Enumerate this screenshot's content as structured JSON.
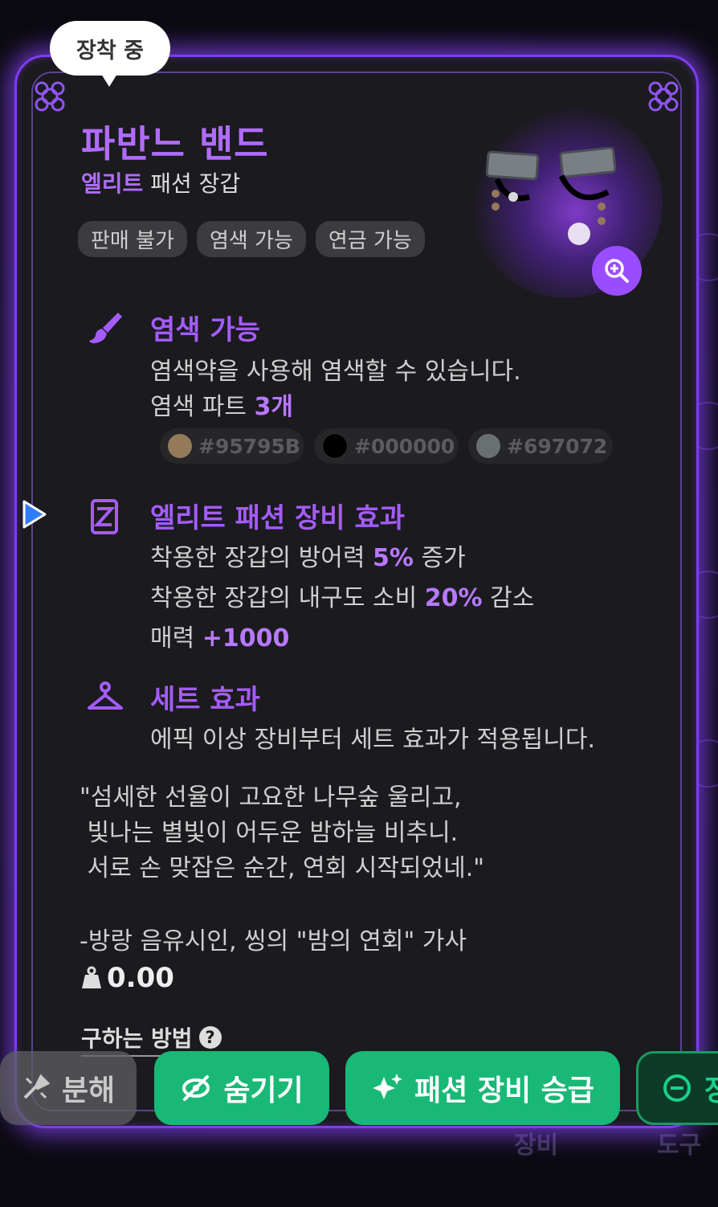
{
  "badge": {
    "equipped": "장착 중"
  },
  "item": {
    "name": "파반느 밴드",
    "grade": "엘리트",
    "type": "패션 장갑",
    "icon": "glove-bracelet-image"
  },
  "chips": [
    "판매 불가",
    "염색 가능",
    "연금 가능"
  ],
  "zoom_icon": "zoom-in-icon",
  "dye": {
    "icon": "brush-icon",
    "title": "염색 가능",
    "desc": "염색약을 사용해 염색할 수 있습니다.",
    "parts_label": "염색 파트",
    "parts_count": "3개",
    "colors": [
      {
        "code": "#95795B",
        "color": "#95795B"
      },
      {
        "code": "#000000",
        "color": "#000000"
      },
      {
        "code": "#697072",
        "color": "#697072"
      }
    ]
  },
  "elite_effect": {
    "icon": "fashion-card-icon",
    "title": "엘리트 패션 장비 효과",
    "line1_text": "착용한 장갑의 방어력",
    "line1_value": "5%",
    "line1_suffix": "증가",
    "line2_text": "착용한 장갑의 내구도 소비",
    "line2_value": "20%",
    "line2_suffix": "감소",
    "line3_text": "매력",
    "line3_value": "+1000"
  },
  "set_effect": {
    "icon": "hanger-icon",
    "title": "세트 효과",
    "desc": "에픽 이상 장비부터 세트 효과가 적용됩니다."
  },
  "flavor": {
    "quote": "\"섬세한 선율이 고요한 나무숲 울리고,\n 빛나는 별빛이 어두운 밤하늘 비추니.\n 서로 손 맞잡은 순간, 연회 시작되었네.\"",
    "author": "-방랑 음유시인, 씽의 \"밤의 연회\" 가사"
  },
  "weight": {
    "icon": "weight-icon",
    "value": "0.00"
  },
  "how_to": {
    "label": "구하는 방법",
    "icon": "help-icon"
  },
  "buttons": {
    "disassemble": "분해",
    "hide": "숨기기",
    "upgrade": "패션 장비 승급",
    "unequip": "장"
  },
  "bottom_nav": {
    "equipment": "장비",
    "tools": "도구"
  },
  "colors": {
    "accent": "#9a4dff",
    "title": "#b06cff",
    "green": "#19b877",
    "card_bg": "#1b1a1e"
  }
}
